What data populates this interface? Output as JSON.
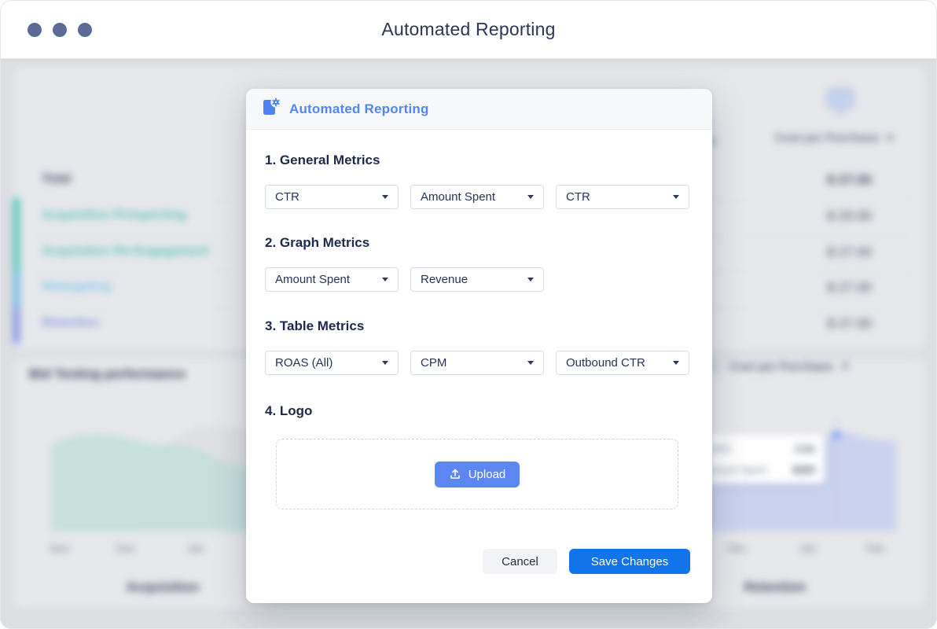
{
  "window": {
    "title": "Automated Reporting"
  },
  "modal": {
    "title": "Automated Reporting",
    "sections": [
      {
        "heading": "1. General Metrics",
        "selects": [
          "CTR",
          "Amount Spent",
          "CTR"
        ]
      },
      {
        "heading": "2. Graph Metrics",
        "selects": [
          "Amount Spent",
          "Revenue"
        ]
      },
      {
        "heading": "3. Table Metrics",
        "selects": [
          "ROAS (All)",
          "CPM",
          "Outbound CTR"
        ]
      },
      {
        "heading": "4. Logo"
      }
    ],
    "upload_label": "Upload",
    "cancel_label": "Cancel",
    "save_label": "Save Changes",
    "colors": {
      "accent": "#5486F0",
      "upload": "#5C87F0",
      "save": "#1273EA"
    }
  },
  "background": {
    "table": {
      "column_header": "Cost per Purchase",
      "rows": [
        {
          "label": "Total",
          "value": "$ 27.00"
        },
        {
          "label": "Acquisition Prospecting",
          "value": "$ 20.00"
        },
        {
          "label": "Acquisition Re-Engagement",
          "value": "$ 27.00"
        },
        {
          "label": "Retargeting",
          "value": "$ 27.00"
        },
        {
          "label": "Retention",
          "value": "$ 27.00"
        }
      ],
      "row_colors": {
        "acquisition": "#4FC0B5",
        "retargeting": "#76C4E8",
        "retention": "#8095E2"
      }
    },
    "charts": {
      "title": "Bid Testing performance",
      "selector_label": "Cost per Purchase",
      "left": {
        "x_labels": [
          "Nov",
          "Dec",
          "Jan"
        ],
        "caption": "Acquisition"
      },
      "right": {
        "x_labels": [
          "Dec",
          "Jan",
          "Feb"
        ],
        "caption": "Retention",
        "tooltip": {
          "rows": [
            {
              "label": "ROAS",
              "value": "2.4x"
            },
            {
              "label": "Amount Spent",
              "value": "$305"
            }
          ]
        }
      }
    }
  }
}
